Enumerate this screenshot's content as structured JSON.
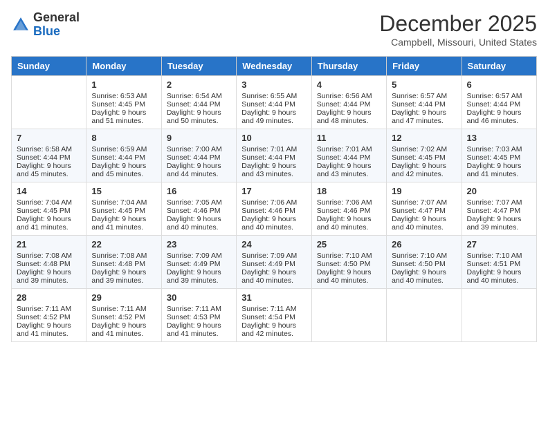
{
  "header": {
    "logo_general": "General",
    "logo_blue": "Blue",
    "month_year": "December 2025",
    "location": "Campbell, Missouri, United States"
  },
  "weekdays": [
    "Sunday",
    "Monday",
    "Tuesday",
    "Wednesday",
    "Thursday",
    "Friday",
    "Saturday"
  ],
  "weeks": [
    [
      {
        "day": "",
        "sunrise": "",
        "sunset": "",
        "daylight": ""
      },
      {
        "day": "1",
        "sunrise": "Sunrise: 6:53 AM",
        "sunset": "Sunset: 4:45 PM",
        "daylight": "Daylight: 9 hours and 51 minutes."
      },
      {
        "day": "2",
        "sunrise": "Sunrise: 6:54 AM",
        "sunset": "Sunset: 4:44 PM",
        "daylight": "Daylight: 9 hours and 50 minutes."
      },
      {
        "day": "3",
        "sunrise": "Sunrise: 6:55 AM",
        "sunset": "Sunset: 4:44 PM",
        "daylight": "Daylight: 9 hours and 49 minutes."
      },
      {
        "day": "4",
        "sunrise": "Sunrise: 6:56 AM",
        "sunset": "Sunset: 4:44 PM",
        "daylight": "Daylight: 9 hours and 48 minutes."
      },
      {
        "day": "5",
        "sunrise": "Sunrise: 6:57 AM",
        "sunset": "Sunset: 4:44 PM",
        "daylight": "Daylight: 9 hours and 47 minutes."
      },
      {
        "day": "6",
        "sunrise": "Sunrise: 6:57 AM",
        "sunset": "Sunset: 4:44 PM",
        "daylight": "Daylight: 9 hours and 46 minutes."
      }
    ],
    [
      {
        "day": "7",
        "sunrise": "Sunrise: 6:58 AM",
        "sunset": "Sunset: 4:44 PM",
        "daylight": "Daylight: 9 hours and 45 minutes."
      },
      {
        "day": "8",
        "sunrise": "Sunrise: 6:59 AM",
        "sunset": "Sunset: 4:44 PM",
        "daylight": "Daylight: 9 hours and 45 minutes."
      },
      {
        "day": "9",
        "sunrise": "Sunrise: 7:00 AM",
        "sunset": "Sunset: 4:44 PM",
        "daylight": "Daylight: 9 hours and 44 minutes."
      },
      {
        "day": "10",
        "sunrise": "Sunrise: 7:01 AM",
        "sunset": "Sunset: 4:44 PM",
        "daylight": "Daylight: 9 hours and 43 minutes."
      },
      {
        "day": "11",
        "sunrise": "Sunrise: 7:01 AM",
        "sunset": "Sunset: 4:44 PM",
        "daylight": "Daylight: 9 hours and 43 minutes."
      },
      {
        "day": "12",
        "sunrise": "Sunrise: 7:02 AM",
        "sunset": "Sunset: 4:45 PM",
        "daylight": "Daylight: 9 hours and 42 minutes."
      },
      {
        "day": "13",
        "sunrise": "Sunrise: 7:03 AM",
        "sunset": "Sunset: 4:45 PM",
        "daylight": "Daylight: 9 hours and 41 minutes."
      }
    ],
    [
      {
        "day": "14",
        "sunrise": "Sunrise: 7:04 AM",
        "sunset": "Sunset: 4:45 PM",
        "daylight": "Daylight: 9 hours and 41 minutes."
      },
      {
        "day": "15",
        "sunrise": "Sunrise: 7:04 AM",
        "sunset": "Sunset: 4:45 PM",
        "daylight": "Daylight: 9 hours and 41 minutes."
      },
      {
        "day": "16",
        "sunrise": "Sunrise: 7:05 AM",
        "sunset": "Sunset: 4:46 PM",
        "daylight": "Daylight: 9 hours and 40 minutes."
      },
      {
        "day": "17",
        "sunrise": "Sunrise: 7:06 AM",
        "sunset": "Sunset: 4:46 PM",
        "daylight": "Daylight: 9 hours and 40 minutes."
      },
      {
        "day": "18",
        "sunrise": "Sunrise: 7:06 AM",
        "sunset": "Sunset: 4:46 PM",
        "daylight": "Daylight: 9 hours and 40 minutes."
      },
      {
        "day": "19",
        "sunrise": "Sunrise: 7:07 AM",
        "sunset": "Sunset: 4:47 PM",
        "daylight": "Daylight: 9 hours and 40 minutes."
      },
      {
        "day": "20",
        "sunrise": "Sunrise: 7:07 AM",
        "sunset": "Sunset: 4:47 PM",
        "daylight": "Daylight: 9 hours and 39 minutes."
      }
    ],
    [
      {
        "day": "21",
        "sunrise": "Sunrise: 7:08 AM",
        "sunset": "Sunset: 4:48 PM",
        "daylight": "Daylight: 9 hours and 39 minutes."
      },
      {
        "day": "22",
        "sunrise": "Sunrise: 7:08 AM",
        "sunset": "Sunset: 4:48 PM",
        "daylight": "Daylight: 9 hours and 39 minutes."
      },
      {
        "day": "23",
        "sunrise": "Sunrise: 7:09 AM",
        "sunset": "Sunset: 4:49 PM",
        "daylight": "Daylight: 9 hours and 39 minutes."
      },
      {
        "day": "24",
        "sunrise": "Sunrise: 7:09 AM",
        "sunset": "Sunset: 4:49 PM",
        "daylight": "Daylight: 9 hours and 40 minutes."
      },
      {
        "day": "25",
        "sunrise": "Sunrise: 7:10 AM",
        "sunset": "Sunset: 4:50 PM",
        "daylight": "Daylight: 9 hours and 40 minutes."
      },
      {
        "day": "26",
        "sunrise": "Sunrise: 7:10 AM",
        "sunset": "Sunset: 4:50 PM",
        "daylight": "Daylight: 9 hours and 40 minutes."
      },
      {
        "day": "27",
        "sunrise": "Sunrise: 7:10 AM",
        "sunset": "Sunset: 4:51 PM",
        "daylight": "Daylight: 9 hours and 40 minutes."
      }
    ],
    [
      {
        "day": "28",
        "sunrise": "Sunrise: 7:11 AM",
        "sunset": "Sunset: 4:52 PM",
        "daylight": "Daylight: 9 hours and 41 minutes."
      },
      {
        "day": "29",
        "sunrise": "Sunrise: 7:11 AM",
        "sunset": "Sunset: 4:52 PM",
        "daylight": "Daylight: 9 hours and 41 minutes."
      },
      {
        "day": "30",
        "sunrise": "Sunrise: 7:11 AM",
        "sunset": "Sunset: 4:53 PM",
        "daylight": "Daylight: 9 hours and 41 minutes."
      },
      {
        "day": "31",
        "sunrise": "Sunrise: 7:11 AM",
        "sunset": "Sunset: 4:54 PM",
        "daylight": "Daylight: 9 hours and 42 minutes."
      },
      {
        "day": "",
        "sunrise": "",
        "sunset": "",
        "daylight": ""
      },
      {
        "day": "",
        "sunrise": "",
        "sunset": "",
        "daylight": ""
      },
      {
        "day": "",
        "sunrise": "",
        "sunset": "",
        "daylight": ""
      }
    ]
  ]
}
